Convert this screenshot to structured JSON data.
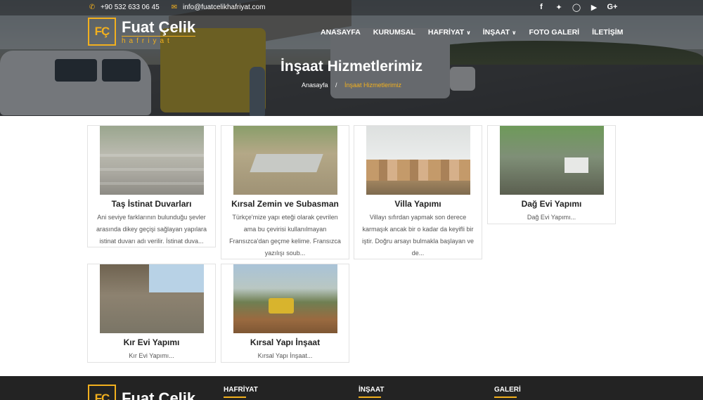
{
  "topbar": {
    "phone": "+90 532 633 06 45",
    "email": "info@fuatcelikhafriyat.com",
    "social_icons": [
      "facebook-icon",
      "twitter-icon",
      "instagram-icon",
      "youtube-icon",
      "google-plus-icon"
    ]
  },
  "brand": {
    "monogram": "FÇ",
    "name": "Fuat Çelik",
    "sub": "hafriyat",
    "accent_color": "#f2b01e"
  },
  "nav": {
    "items": [
      {
        "label": "ANASAYFA"
      },
      {
        "label": "KURUMSAL"
      },
      {
        "label": "HAFRİYAT",
        "dropdown": true
      },
      {
        "label": "İNŞAAT",
        "dropdown": true
      },
      {
        "label": "FOTO GALERİ"
      },
      {
        "label": "İLETİŞİM"
      }
    ]
  },
  "hero": {
    "title": "İnşaat Hizmetlerimiz",
    "breadcrumb": {
      "home": "Anasayfa",
      "separator": "/",
      "current": "İnşaat Hizmetlerimiz"
    }
  },
  "cards": [
    {
      "title": "Taş İstinat Duvarları",
      "desc": "Ani seviye farklarının bulunduğu şevler arasında dikey geçişi sağlayan yapılara istinat duvarı adı verilir. İstinat duva..."
    },
    {
      "title": "Kırsal Zemin ve Subasman",
      "desc": "Türkçe'mize yapı eteği olarak çevrilen ama bu çevirisi kullanılmayan Fransızca'dan geçme kelime. Fransızca yazılışı soub..."
    },
    {
      "title": "Villa Yapımı",
      "desc": "Villayı sıfırdan yapmak son derece karmaşık ancak bir o kadar da keyifli bir iştir. Doğru arsayı bulmakla başlayan ve de..."
    },
    {
      "title": "Dağ Evi Yapımı",
      "desc": "Dağ Evi Yapımı..."
    },
    {
      "title": "Kır Evi Yapımı",
      "desc": "Kır Evi Yapımı..."
    },
    {
      "title": "Kırsal Yapı İnşaat",
      "desc": "Kırsal Yapı İnşaat..."
    }
  ],
  "footer": {
    "headings": [
      "HAFRİYAT",
      "İNŞAAT",
      "GALERİ"
    ]
  }
}
